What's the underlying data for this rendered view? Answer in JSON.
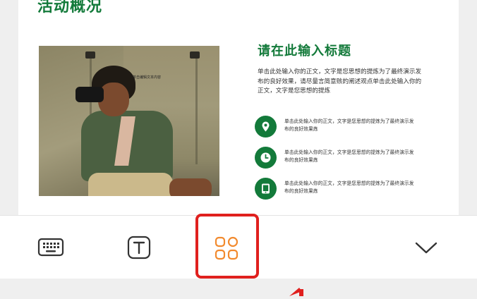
{
  "slide": {
    "title": "活动概况",
    "photo_caption": "单击编辑文本内容",
    "heading": "请在此输入标题",
    "body": "单击此处输入你的正文，文字是您思想的提炼为了最终演示发布的良好效果，请尽量言简意赅的阐述观点单击此处输入你的正文，文字是您思想的提炼",
    "features": [
      {
        "icon": "location-pin-icon",
        "text": "单击此处输入你的正文，文字是您思想的提炼为了最终演示发布的良好效果炼"
      },
      {
        "icon": "clock-icon",
        "text": "单击此处输入你的正文，文字是您思想的提炼为了最终演示发布的良好效果炼"
      },
      {
        "icon": "tablet-icon",
        "text": "单击此处输入你的正文，文字是您思想的提炼为了最终演示发布的良好效果炼"
      }
    ]
  },
  "toolbar": {
    "buttons": [
      {
        "name": "keyboard-button",
        "icon": "keyboard-icon"
      },
      {
        "name": "text-format-button",
        "icon": "text-format-icon"
      },
      {
        "name": "more-tools-button",
        "icon": "grid-apps-icon"
      },
      {
        "name": "collapse-button",
        "icon": "chevron-down-icon"
      }
    ]
  },
  "colors": {
    "brand_green": "#137a3a",
    "accent_orange": "#f28a2e",
    "highlight_red": "#e0201e"
  }
}
